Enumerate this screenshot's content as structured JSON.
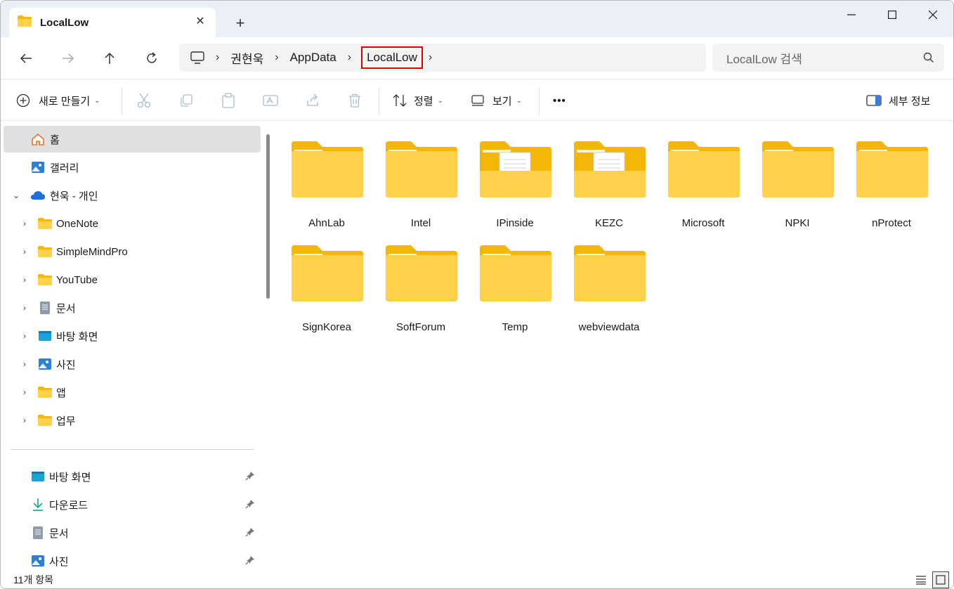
{
  "window": {
    "tab_title": "LocalLow",
    "tab_icon": "folder-icon",
    "close_tab": "✕",
    "new_tab": "+",
    "minimize": "minimize-icon",
    "maximize": "maximize-icon",
    "close": "close-icon"
  },
  "address": {
    "crumbs": [
      "권현욱",
      "AppData",
      "LocalLow"
    ],
    "search_placeholder": "LocalLow 검색"
  },
  "toolbar": {
    "new_label": "새로 만들기",
    "sort_label": "정렬",
    "view_label": "보기",
    "more_label": "•••",
    "details_label": "세부 정보"
  },
  "sidebar": {
    "items": [
      {
        "label": "홈",
        "icon": "home-icon"
      },
      {
        "label": "갤러리",
        "icon": "gallery-icon"
      },
      {
        "label": "현욱 - 개인",
        "icon": "onedrive-icon"
      },
      {
        "label": "OneNote",
        "icon": "folder-icon"
      },
      {
        "label": "SimpleMindPro",
        "icon": "folder-icon"
      },
      {
        "label": "YouTube",
        "icon": "folder-icon"
      },
      {
        "label": "문서",
        "icon": "document-icon"
      },
      {
        "label": "바탕 화면",
        "icon": "desktop-icon"
      },
      {
        "label": "사진",
        "icon": "pictures-icon"
      },
      {
        "label": "앱",
        "icon": "folder-icon"
      },
      {
        "label": "업무",
        "icon": "folder-icon"
      }
    ],
    "pinned": [
      {
        "label": "바탕 화면",
        "icon": "desktop-icon"
      },
      {
        "label": "다운로드",
        "icon": "download-icon"
      },
      {
        "label": "문서",
        "icon": "document-icon"
      },
      {
        "label": "사진",
        "icon": "pictures-icon"
      }
    ]
  },
  "folders": [
    {
      "name": "AhnLab",
      "has_files": false
    },
    {
      "name": "Intel",
      "has_files": false
    },
    {
      "name": "IPinside",
      "has_files": true
    },
    {
      "name": "KEZC",
      "has_files": true
    },
    {
      "name": "Microsoft",
      "has_files": false
    },
    {
      "name": "NPKI",
      "has_files": false
    },
    {
      "name": "nProtect",
      "has_files": false
    },
    {
      "name": "SignKorea",
      "has_files": false
    },
    {
      "name": "SoftForum",
      "has_files": false
    },
    {
      "name": "Temp",
      "has_files": false
    },
    {
      "name": "webviewdata",
      "has_files": false
    }
  ],
  "status": {
    "item_count": "11개 항목"
  },
  "colors": {
    "folder_back": "#f5b60a",
    "folder_front": "#ffd04a",
    "selection_red": "#e00000",
    "titlebar_bg": "#eaf0f6"
  }
}
